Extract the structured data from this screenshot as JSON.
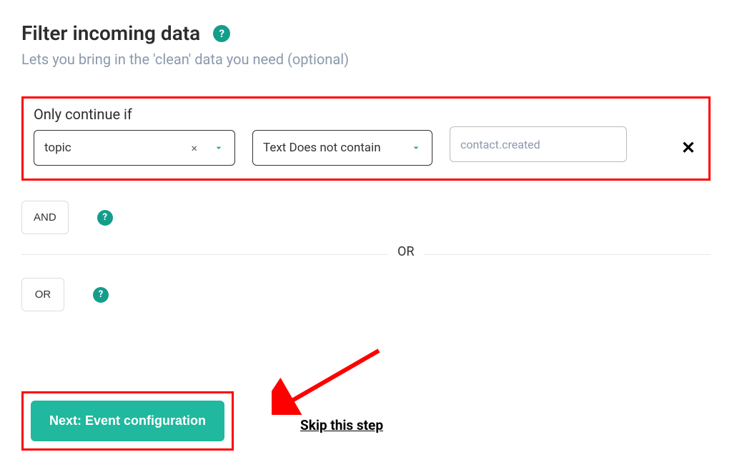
{
  "header": {
    "title": "Filter incoming data",
    "subtitle": "Lets you bring in the 'clean' data you need (optional)"
  },
  "filter": {
    "label": "Only continue if",
    "field_value": "topic",
    "operator_value": "Text Does not contain",
    "text_value": "contact.created"
  },
  "logic": {
    "and_label": "AND",
    "or_label": "OR",
    "divider_label": "OR"
  },
  "footer": {
    "next_label": "Next: Event configuration",
    "skip_label": "Skip this step"
  },
  "icons": {
    "help": "?",
    "clear": "×",
    "remove": "✕"
  }
}
